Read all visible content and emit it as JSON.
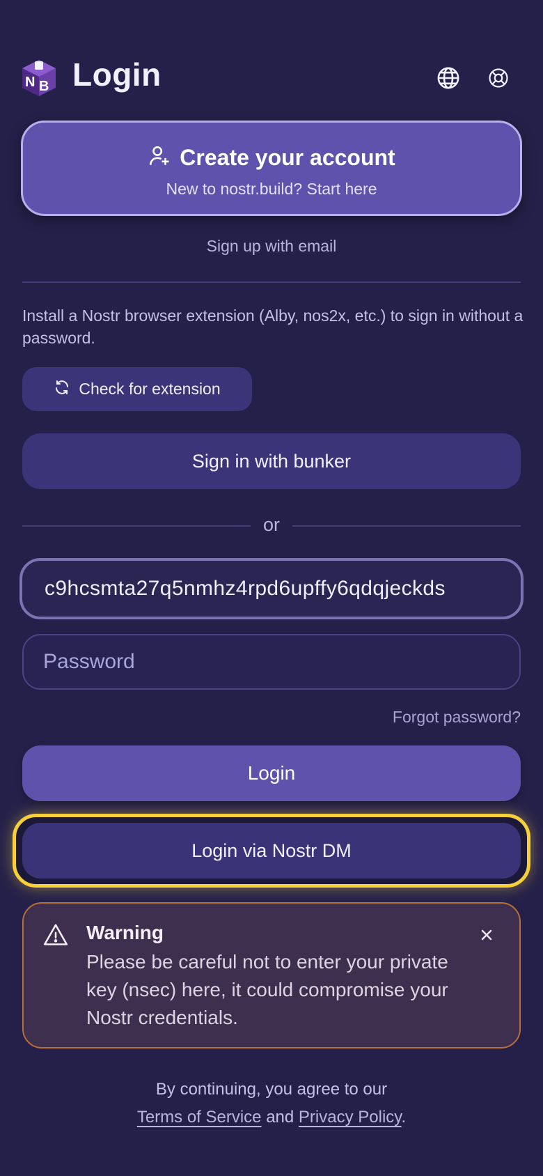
{
  "header": {
    "title": "Login",
    "logo_text": "NB",
    "icons": [
      "globe-icon",
      "lifebuoy-icon"
    ]
  },
  "create_account": {
    "title": "Create your account",
    "subtitle": "New to nostr.build? Start here",
    "icon": "user-plus-icon"
  },
  "email_signup": "Sign up with email",
  "extension": {
    "info": "Install a Nostr browser extension (Alby, nos2x, etc.) to sign in without a password.",
    "check_label": "Check for extension",
    "icon": "refresh-icon"
  },
  "bunker_label": "Sign in with bunker",
  "or_label": "or",
  "form": {
    "username_value": "c9hcsmta27q5nmhz4rpd6upffy6qdqjeckds",
    "password_placeholder": "Password",
    "forgot_label": "Forgot password?",
    "login_label": "Login",
    "dm_login_label": "Login via Nostr DM"
  },
  "warning": {
    "title": "Warning",
    "body": "Please be careful not to enter your private key (nsec) here, it could compromise your Nostr credentials.",
    "icon": "warning-icon"
  },
  "footer": {
    "line1": "By continuing, you agree to our",
    "terms_label": "Terms of Service",
    "and_label": "and",
    "privacy_label": "Privacy Policy",
    "period": "."
  },
  "colors": {
    "background": "#242049",
    "primary": "#5e52ad",
    "secondary_button": "#3b3478",
    "highlight": "#f6cf3a",
    "warning_border": "#b46f3c"
  }
}
